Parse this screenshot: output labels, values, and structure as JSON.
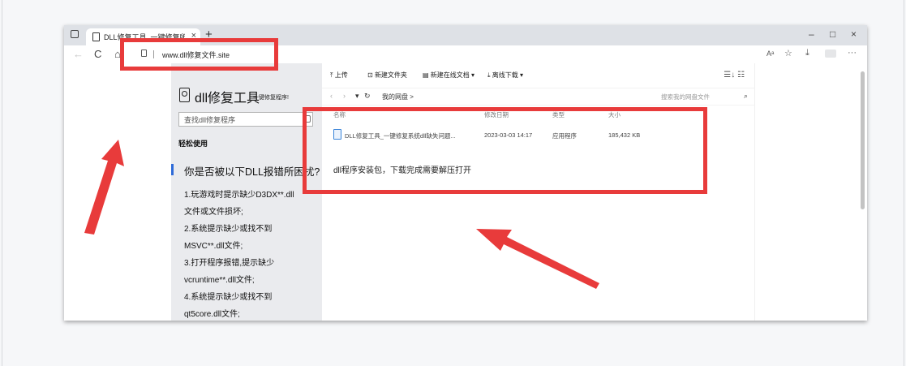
{
  "browser": {
    "tab_title": "DLL修复工具_一键修复所有dll缺失问题",
    "tab_close": "×",
    "new_tab": "+",
    "window_controls": {
      "minimize": "–",
      "maximize": "□",
      "close": "×"
    },
    "nav": {
      "back": "←",
      "refresh": "C",
      "home": "⌂"
    },
    "address": "www.dll修复文件.site",
    "toolbar_icons": {
      "read_aloud": "Aᵃ",
      "favorites": "☆",
      "downloads": "⤓",
      "more": "···"
    }
  },
  "sidebar": {
    "brand_title": "dll修复工具",
    "brand_subtitle": "一键修复程序!",
    "search_placeholder": "查找dll修复程序",
    "easy_use": "轻松使用",
    "question": "你是否被以下DLL报错所困扰?",
    "items": [
      "1.玩游戏时提示缺少D3DX**.dll",
      "文件或文件损坏;",
      "2.系统提示缺少或找不到",
      "MSVC**.dll文件;",
      "3.打开程序报错,提示缺少",
      "vcruntime**.dll文件;",
      "4.系统提示缺少或找不到",
      "qt5core.dll文件;"
    ]
  },
  "netdisk": {
    "tools": {
      "upload": "上传",
      "new_folder": "新建文件夹",
      "new_doc": "新建在线文档",
      "offline_download": "离线下载"
    },
    "view_toggle": "☰↓ ☷",
    "crumb": "我的网盘",
    "crumb_sep": ">",
    "search_placeholder": "搜索我的网盘文件",
    "columns": {
      "name": "名称",
      "modified": "修改日期",
      "type": "类型",
      "size": "大小"
    },
    "file": {
      "name": "DLL修复工具_一键修复系统dll缺失问题...",
      "modified": "2023-03-03 14:17",
      "type": "应用程序",
      "size": "185,432 KB"
    },
    "note": "dll程序安装包，下载完成需要解压打开"
  },
  "annotations": {
    "color": "#e83b3b"
  }
}
